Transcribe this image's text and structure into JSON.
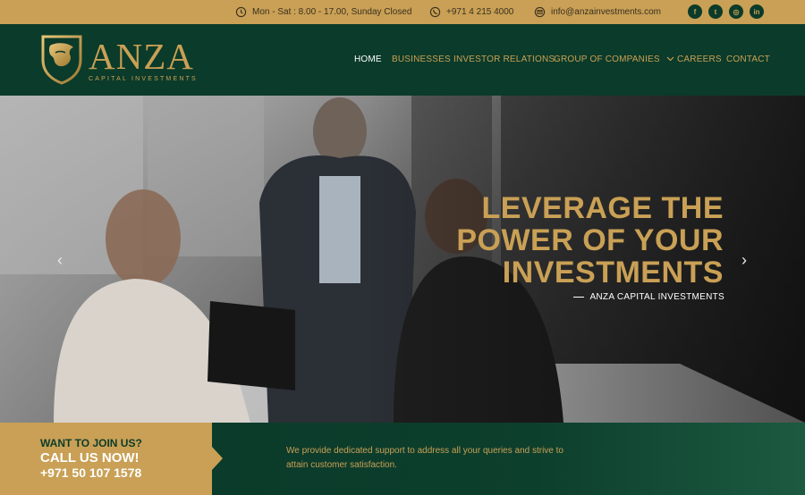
{
  "topbar": {
    "hours": "Mon - Sat : 8.00 - 17.00, Sunday Closed",
    "phone": "+971 4 215 4000",
    "email": "info@anzainvestments.com",
    "socials": [
      {
        "icon": "facebook-icon",
        "glyph": "f"
      },
      {
        "icon": "twitter-icon",
        "glyph": "t"
      },
      {
        "icon": "instagram-icon",
        "glyph": "◎"
      },
      {
        "icon": "linkedin-icon",
        "glyph": "in"
      }
    ]
  },
  "brand": {
    "name": "ANZA",
    "sub": "CAPITAL INVESTMENTS"
  },
  "nav": {
    "items": [
      {
        "label": "HOME",
        "active": true
      },
      {
        "label": "BUSINESSES"
      },
      {
        "label": "INVESTOR RELATIONS"
      },
      {
        "label": "GROUP OF COMPANIES",
        "dropdown": true
      },
      {
        "label": "CAREERS"
      },
      {
        "label": "CONTACT"
      }
    ]
  },
  "hero": {
    "headline": [
      "LEVERAGE THE",
      "POWER OF YOUR",
      "INVESTMENTS"
    ],
    "tagline": "ANZA CAPITAL INVESTMENTS",
    "prev_arrow": "‹",
    "next_arrow": "›"
  },
  "cta": {
    "line1": "WANT TO JOIN US?",
    "line2": "CALL US NOW!",
    "line3": "+971 50 107 1578"
  },
  "support": {
    "text": "We provide dedicated support to address all your queries and strive to attain customer satisfaction."
  },
  "colors": {
    "gold": "#c9a055",
    "dark_green": "#0b3b2a"
  }
}
